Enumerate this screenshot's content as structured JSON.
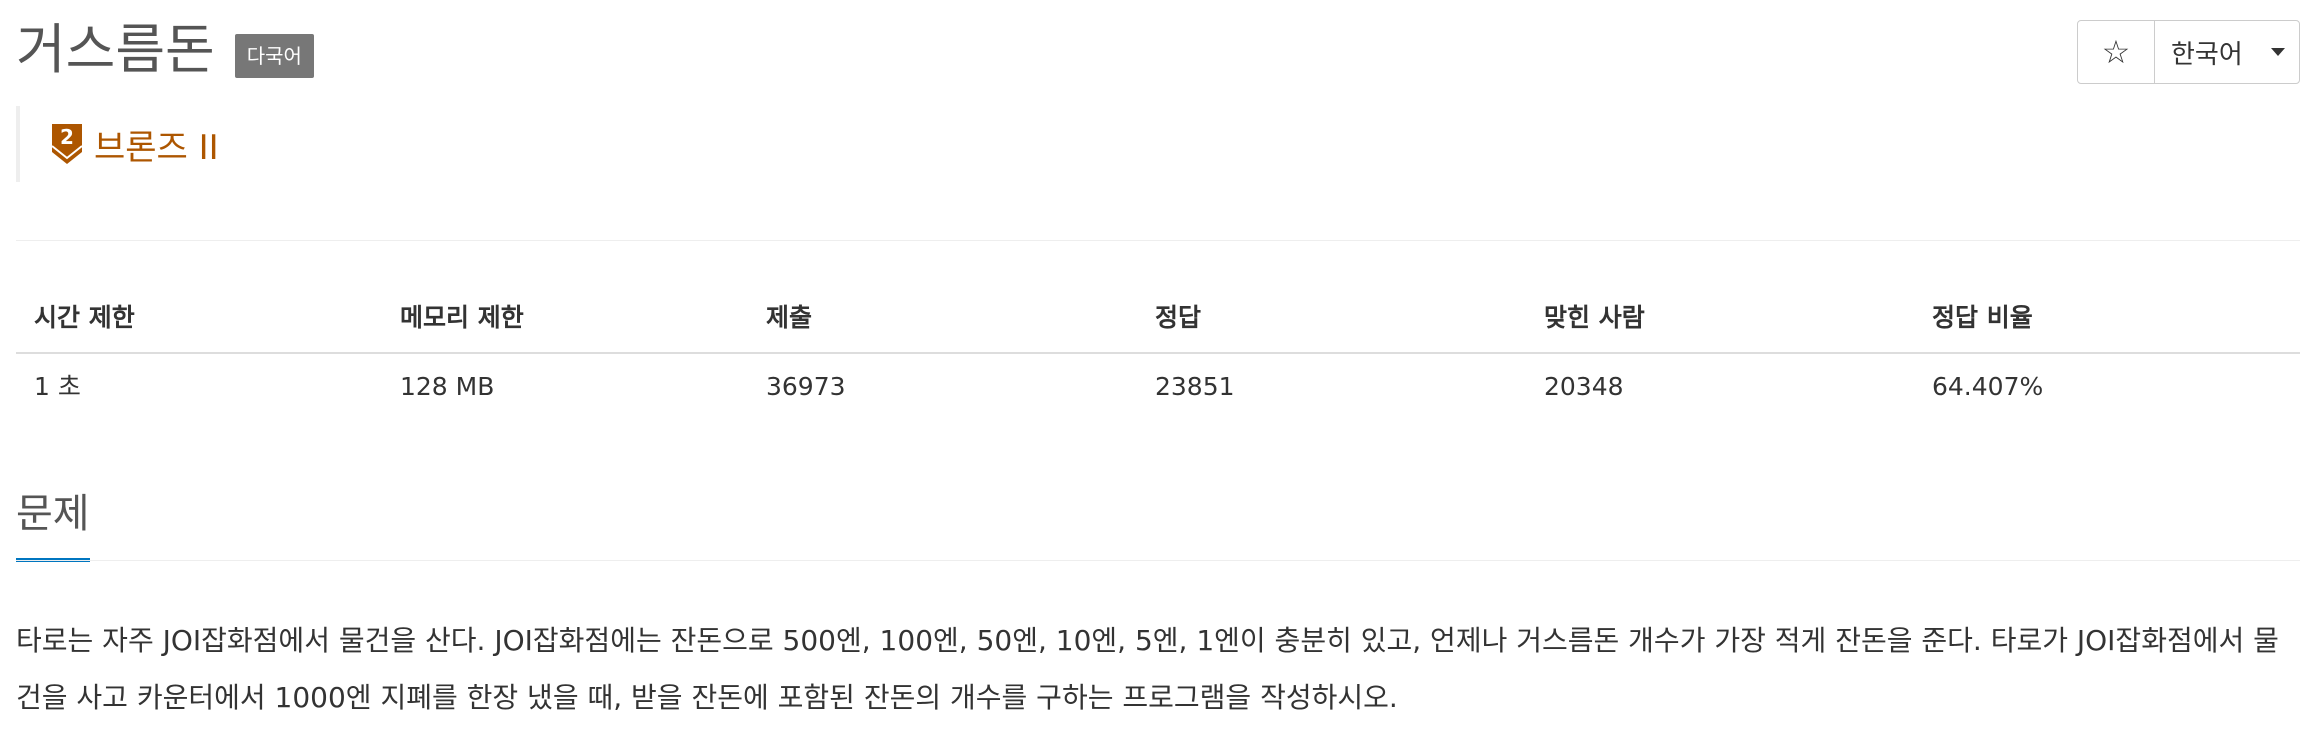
{
  "problem": {
    "title": "거스름돈",
    "multi_language_badge": "다국어",
    "tier": {
      "label": "브론즈 II",
      "level_number": "2",
      "color": "#ad5600"
    }
  },
  "controls": {
    "star_icon": "☆",
    "language_label": "한국어"
  },
  "info_table": {
    "headers": [
      "시간 제한",
      "메모리 제한",
      "제출",
      "정답",
      "맞힌 사람",
      "정답 비율"
    ],
    "values": [
      "1 초",
      "128 MB",
      "36973",
      "23851",
      "20348",
      "64.407%"
    ]
  },
  "section": {
    "title": "문제",
    "accent_color": "#0076c0"
  },
  "description": "타로는 자주 JOI잡화점에서 물건을 산다. JOI잡화점에는 잔돈으로 500엔, 100엔, 50엔, 10엔, 5엔, 1엔이 충분히 있고, 언제나 거스름돈 개수가 가장 적게 잔돈을 준다. 타로가 JOI잡화점에서 물건을 사고 카운터에서 1000엔 지폐를 한장 냈을 때, 받을 잔돈에 포함된 잔돈의 개수를 구하는 프로그램을 작성하시오."
}
